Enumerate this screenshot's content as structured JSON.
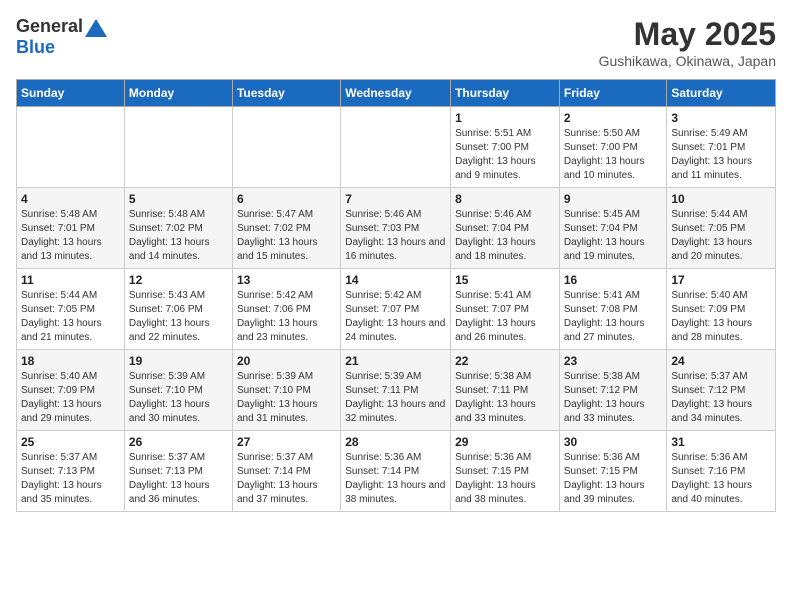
{
  "header": {
    "logo_general": "General",
    "logo_blue": "Blue",
    "month_year": "May 2025",
    "location": "Gushikawa, Okinawa, Japan"
  },
  "weekdays": [
    "Sunday",
    "Monday",
    "Tuesday",
    "Wednesday",
    "Thursday",
    "Friday",
    "Saturday"
  ],
  "weeks": [
    [
      {
        "day": "",
        "sunrise": "",
        "sunset": "",
        "daylight": ""
      },
      {
        "day": "",
        "sunrise": "",
        "sunset": "",
        "daylight": ""
      },
      {
        "day": "",
        "sunrise": "",
        "sunset": "",
        "daylight": ""
      },
      {
        "day": "",
        "sunrise": "",
        "sunset": "",
        "daylight": ""
      },
      {
        "day": "1",
        "sunrise": "Sunrise: 5:51 AM",
        "sunset": "Sunset: 7:00 PM",
        "daylight": "Daylight: 13 hours and 9 minutes."
      },
      {
        "day": "2",
        "sunrise": "Sunrise: 5:50 AM",
        "sunset": "Sunset: 7:00 PM",
        "daylight": "Daylight: 13 hours and 10 minutes."
      },
      {
        "day": "3",
        "sunrise": "Sunrise: 5:49 AM",
        "sunset": "Sunset: 7:01 PM",
        "daylight": "Daylight: 13 hours and 11 minutes."
      }
    ],
    [
      {
        "day": "4",
        "sunrise": "Sunrise: 5:48 AM",
        "sunset": "Sunset: 7:01 PM",
        "daylight": "Daylight: 13 hours and 13 minutes."
      },
      {
        "day": "5",
        "sunrise": "Sunrise: 5:48 AM",
        "sunset": "Sunset: 7:02 PM",
        "daylight": "Daylight: 13 hours and 14 minutes."
      },
      {
        "day": "6",
        "sunrise": "Sunrise: 5:47 AM",
        "sunset": "Sunset: 7:02 PM",
        "daylight": "Daylight: 13 hours and 15 minutes."
      },
      {
        "day": "7",
        "sunrise": "Sunrise: 5:46 AM",
        "sunset": "Sunset: 7:03 PM",
        "daylight": "Daylight: 13 hours and 16 minutes."
      },
      {
        "day": "8",
        "sunrise": "Sunrise: 5:46 AM",
        "sunset": "Sunset: 7:04 PM",
        "daylight": "Daylight: 13 hours and 18 minutes."
      },
      {
        "day": "9",
        "sunrise": "Sunrise: 5:45 AM",
        "sunset": "Sunset: 7:04 PM",
        "daylight": "Daylight: 13 hours and 19 minutes."
      },
      {
        "day": "10",
        "sunrise": "Sunrise: 5:44 AM",
        "sunset": "Sunset: 7:05 PM",
        "daylight": "Daylight: 13 hours and 20 minutes."
      }
    ],
    [
      {
        "day": "11",
        "sunrise": "Sunrise: 5:44 AM",
        "sunset": "Sunset: 7:05 PM",
        "daylight": "Daylight: 13 hours and 21 minutes."
      },
      {
        "day": "12",
        "sunrise": "Sunrise: 5:43 AM",
        "sunset": "Sunset: 7:06 PM",
        "daylight": "Daylight: 13 hours and 22 minutes."
      },
      {
        "day": "13",
        "sunrise": "Sunrise: 5:42 AM",
        "sunset": "Sunset: 7:06 PM",
        "daylight": "Daylight: 13 hours and 23 minutes."
      },
      {
        "day": "14",
        "sunrise": "Sunrise: 5:42 AM",
        "sunset": "Sunset: 7:07 PM",
        "daylight": "Daylight: 13 hours and 24 minutes."
      },
      {
        "day": "15",
        "sunrise": "Sunrise: 5:41 AM",
        "sunset": "Sunset: 7:07 PM",
        "daylight": "Daylight: 13 hours and 26 minutes."
      },
      {
        "day": "16",
        "sunrise": "Sunrise: 5:41 AM",
        "sunset": "Sunset: 7:08 PM",
        "daylight": "Daylight: 13 hours and 27 minutes."
      },
      {
        "day": "17",
        "sunrise": "Sunrise: 5:40 AM",
        "sunset": "Sunset: 7:09 PM",
        "daylight": "Daylight: 13 hours and 28 minutes."
      }
    ],
    [
      {
        "day": "18",
        "sunrise": "Sunrise: 5:40 AM",
        "sunset": "Sunset: 7:09 PM",
        "daylight": "Daylight: 13 hours and 29 minutes."
      },
      {
        "day": "19",
        "sunrise": "Sunrise: 5:39 AM",
        "sunset": "Sunset: 7:10 PM",
        "daylight": "Daylight: 13 hours and 30 minutes."
      },
      {
        "day": "20",
        "sunrise": "Sunrise: 5:39 AM",
        "sunset": "Sunset: 7:10 PM",
        "daylight": "Daylight: 13 hours and 31 minutes."
      },
      {
        "day": "21",
        "sunrise": "Sunrise: 5:39 AM",
        "sunset": "Sunset: 7:11 PM",
        "daylight": "Daylight: 13 hours and 32 minutes."
      },
      {
        "day": "22",
        "sunrise": "Sunrise: 5:38 AM",
        "sunset": "Sunset: 7:11 PM",
        "daylight": "Daylight: 13 hours and 33 minutes."
      },
      {
        "day": "23",
        "sunrise": "Sunrise: 5:38 AM",
        "sunset": "Sunset: 7:12 PM",
        "daylight": "Daylight: 13 hours and 33 minutes."
      },
      {
        "day": "24",
        "sunrise": "Sunrise: 5:37 AM",
        "sunset": "Sunset: 7:12 PM",
        "daylight": "Daylight: 13 hours and 34 minutes."
      }
    ],
    [
      {
        "day": "25",
        "sunrise": "Sunrise: 5:37 AM",
        "sunset": "Sunset: 7:13 PM",
        "daylight": "Daylight: 13 hours and 35 minutes."
      },
      {
        "day": "26",
        "sunrise": "Sunrise: 5:37 AM",
        "sunset": "Sunset: 7:13 PM",
        "daylight": "Daylight: 13 hours and 36 minutes."
      },
      {
        "day": "27",
        "sunrise": "Sunrise: 5:37 AM",
        "sunset": "Sunset: 7:14 PM",
        "daylight": "Daylight: 13 hours and 37 minutes."
      },
      {
        "day": "28",
        "sunrise": "Sunrise: 5:36 AM",
        "sunset": "Sunset: 7:14 PM",
        "daylight": "Daylight: 13 hours and 38 minutes."
      },
      {
        "day": "29",
        "sunrise": "Sunrise: 5:36 AM",
        "sunset": "Sunset: 7:15 PM",
        "daylight": "Daylight: 13 hours and 38 minutes."
      },
      {
        "day": "30",
        "sunrise": "Sunrise: 5:36 AM",
        "sunset": "Sunset: 7:15 PM",
        "daylight": "Daylight: 13 hours and 39 minutes."
      },
      {
        "day": "31",
        "sunrise": "Sunrise: 5:36 AM",
        "sunset": "Sunset: 7:16 PM",
        "daylight": "Daylight: 13 hours and 40 minutes."
      }
    ]
  ]
}
